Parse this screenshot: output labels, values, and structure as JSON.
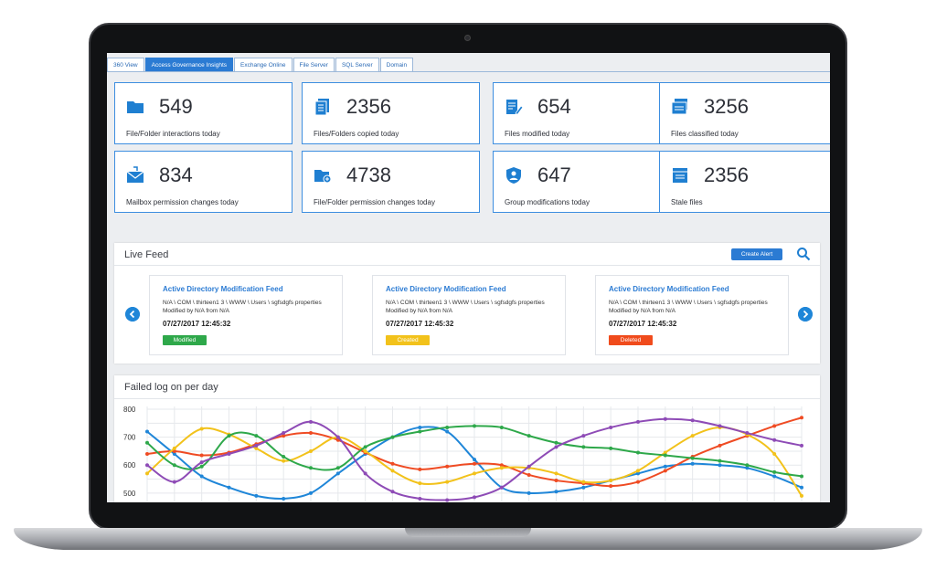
{
  "tabs": [
    {
      "label": "360 View",
      "active": false
    },
    {
      "label": "Access Governance Insights",
      "active": true
    },
    {
      "label": "Exchange Online",
      "active": false
    },
    {
      "label": "File Server",
      "active": false
    },
    {
      "label": "SQL Server",
      "active": false
    },
    {
      "label": "Domain",
      "active": false
    }
  ],
  "stats": [
    {
      "value": "549",
      "label": "File/Folder interactions today",
      "icon": "folder-icon"
    },
    {
      "value": "2356",
      "label": "Files/Folders copied today",
      "icon": "copy-files-icon"
    },
    {
      "value": "654",
      "label": "Files modified today",
      "icon": "edit-file-icon"
    },
    {
      "value": "3256",
      "label": "Files classified today",
      "icon": "classified-files-icon"
    },
    {
      "value": "834",
      "label": "Mailbox permission changes today",
      "icon": "mailbox-icon"
    },
    {
      "value": "4738",
      "label": "File/Folder permission changes today",
      "icon": "folder-permission-icon"
    },
    {
      "value": "647",
      "label": "Group modifications today",
      "icon": "group-icon"
    },
    {
      "value": "2356",
      "label": "Stale files",
      "icon": "stale-files-icon"
    }
  ],
  "live_feed": {
    "title": "Live Feed",
    "create_alert_label": "Create Alert",
    "cards": [
      {
        "title": "Active Directory Modification Feed",
        "text": "N/A \\ COM \\ thirteen1 3 \\ WWW \\ Users \\ sgfsdgfs properties Modified by N/A from N/A",
        "date": "07/27/2017    12:45:32",
        "status": "Modified",
        "status_color": "#2ea84a"
      },
      {
        "title": "Active Directory Modification Feed",
        "text": "N/A \\ COM \\ thirteen1 3 \\ WWW \\ Users \\ sgfsdgfs properties Modified by N/A from N/A",
        "date": "07/27/2017    12:45:32",
        "status": "Created",
        "status_color": "#f2c21b"
      },
      {
        "title": "Active Directory Modification Feed",
        "text": "N/A \\ COM \\ thirteen1 3 \\ WWW \\ Users \\ sgfsdgfs properties Modified by N/A from N/A",
        "date": "07/27/2017    12:45:32",
        "status": "Deleted",
        "status_color": "#f04b1c"
      }
    ]
  },
  "chart_data": {
    "type": "line",
    "title": "Failed log on per day",
    "ylim": [
      470,
      810
    ],
    "yticks": [
      500,
      600,
      700,
      800
    ],
    "grid": true,
    "x": [
      0,
      1,
      2,
      3,
      4,
      5,
      6,
      7,
      8,
      9,
      10,
      11,
      12,
      13,
      14,
      15,
      16,
      17,
      18,
      19,
      20,
      21,
      22,
      23,
      24
    ],
    "series": [
      {
        "color": "#1f86d8",
        "values": [
          720,
          640,
          560,
          520,
          490,
          480,
          500,
          570,
          640,
          700,
          735,
          720,
          620,
          520,
          500,
          505,
          520,
          545,
          570,
          595,
          605,
          600,
          590,
          560,
          520
        ]
      },
      {
        "color": "#ef4b23",
        "values": [
          640,
          650,
          635,
          645,
          675,
          705,
          715,
          690,
          645,
          605,
          585,
          595,
          605,
          600,
          565,
          545,
          535,
          525,
          540,
          580,
          630,
          670,
          705,
          740,
          770
        ]
      },
      {
        "color": "#f2c21b",
        "values": [
          570,
          660,
          730,
          710,
          660,
          615,
          650,
          700,
          650,
          580,
          535,
          540,
          570,
          590,
          590,
          570,
          540,
          545,
          580,
          645,
          705,
          735,
          710,
          640,
          490
        ]
      },
      {
        "color": "#2ea84a",
        "values": [
          680,
          600,
          595,
          705,
          705,
          630,
          590,
          590,
          665,
          700,
          720,
          735,
          740,
          735,
          705,
          680,
          665,
          660,
          645,
          635,
          625,
          615,
          600,
          575,
          560
        ]
      },
      {
        "color": "#8e4bb6",
        "values": [
          600,
          540,
          610,
          640,
          670,
          715,
          755,
          700,
          570,
          505,
          480,
          475,
          485,
          520,
          595,
          665,
          705,
          735,
          755,
          765,
          760,
          740,
          715,
          690,
          670
        ]
      }
    ]
  }
}
